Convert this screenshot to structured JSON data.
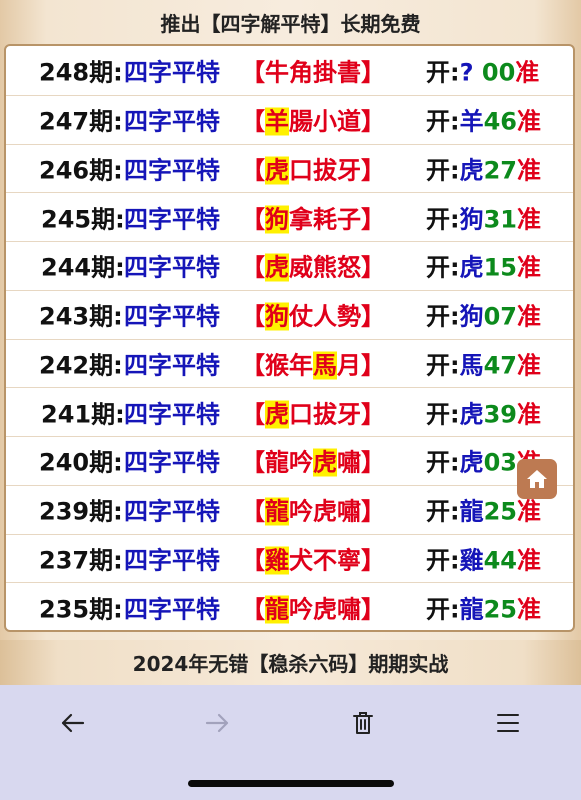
{
  "header": {
    "title": "推出【四字解平特】长期免费"
  },
  "rows": [
    {
      "period": "248期:",
      "label": "四字平特",
      "open": "【",
      "hl": "",
      "rest": "牛角掛書",
      "close": "】",
      "result_prefix": "开:",
      "result_animal": "?",
      "result_num": " 00",
      "result_suffix": "准"
    },
    {
      "period": "247期:",
      "label": "四字平特",
      "open": "【",
      "hl": "羊",
      "rest": "腸小道",
      "close": "】",
      "result_prefix": "开:",
      "result_animal": "羊",
      "result_num": "46",
      "result_suffix": "准"
    },
    {
      "period": "246期:",
      "label": "四字平特",
      "open": "【",
      "hl": "虎",
      "rest": "口拔牙",
      "close": "】",
      "result_prefix": "开:",
      "result_animal": "虎",
      "result_num": "27",
      "result_suffix": "准"
    },
    {
      "period": "245期:",
      "label": "四字平特",
      "open": "【",
      "hl": "狗",
      "rest": "拿耗子",
      "close": "】",
      "result_prefix": "开:",
      "result_animal": "狗",
      "result_num": "31",
      "result_suffix": "准"
    },
    {
      "period": "244期:",
      "label": "四字平特",
      "open": "【",
      "hl": "虎",
      "rest": "威熊怒",
      "close": "】",
      "result_prefix": "开:",
      "result_animal": "虎",
      "result_num": "15",
      "result_suffix": "准"
    },
    {
      "period": "243期:",
      "label": "四字平特",
      "open": "【",
      "hl": "狗",
      "rest": "仗人勢",
      "close": "】",
      "result_prefix": "开:",
      "result_animal": "狗",
      "result_num": "07",
      "result_suffix": "准"
    },
    {
      "period": "242期:",
      "label": "四字平特",
      "open": "【",
      "pre": "猴年",
      "hl": "馬",
      "rest": "月",
      "close": "】",
      "result_prefix": "开:",
      "result_animal": "馬",
      "result_num": "47",
      "result_suffix": "准"
    },
    {
      "period": "241期:",
      "label": "四字平特",
      "open": "【",
      "hl": "虎",
      "rest": "口拔牙",
      "close": "】",
      "result_prefix": "开:",
      "result_animal": "虎",
      "result_num": "39",
      "result_suffix": "准"
    },
    {
      "period": "240期:",
      "label": "四字平特",
      "open": "【",
      "pre": "龍吟",
      "hl": "虎",
      "rest": "嘯",
      "close": "】",
      "result_prefix": "开:",
      "result_animal": "虎",
      "result_num": "03",
      "result_suffix": "准"
    },
    {
      "period": "239期:",
      "label": "四字平特",
      "open": "【",
      "hl": "龍",
      "rest": "吟虎嘯",
      "close": "】",
      "result_prefix": "开:",
      "result_animal": "龍",
      "result_num": "25",
      "result_suffix": "准"
    },
    {
      "period": "237期:",
      "label": "四字平特",
      "open": "【",
      "hl": "雞",
      "rest": "犬不寧",
      "close": "】",
      "result_prefix": "开:",
      "result_animal": "雞",
      "result_num": "44",
      "result_suffix": "准"
    },
    {
      "period": "235期:",
      "label": "四字平特",
      "open": "【",
      "hl": "龍",
      "rest": "吟虎嘯",
      "close": "】",
      "result_prefix": "开:",
      "result_animal": "龍",
      "result_num": "25",
      "result_suffix": "准"
    }
  ],
  "footer": {
    "title": "2024年无错【稳杀六码】期期实战"
  },
  "floating": {
    "icon": "home-icon"
  },
  "toolbar": {
    "back_icon": "back-arrow-icon",
    "forward_icon": "forward-arrow-icon",
    "delete_icon": "trash-icon",
    "menu_icon": "menu-icon"
  },
  "colors": {
    "period": "#111111",
    "label": "#1515b8",
    "bracket": "#e0001a",
    "highlight": "#fff000",
    "number": "#0c8a1c",
    "frame": "#b89468",
    "toolbar_bg": "#d8d8ef",
    "home_button": "#bd7a52"
  }
}
